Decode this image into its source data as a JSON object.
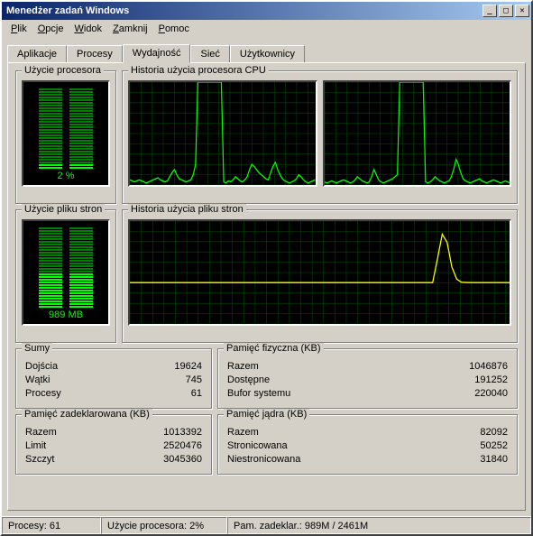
{
  "window": {
    "title": "Menedżer zadań Windows"
  },
  "menu": {
    "file": "Plik",
    "options": "Opcje",
    "view": "Widok",
    "shutdown": "Zamknij",
    "help": "Pomoc"
  },
  "tabs": {
    "apps": "Aplikacje",
    "procs": "Procesy",
    "perf": "Wydajność",
    "net": "Sieć",
    "users": "Użytkownicy"
  },
  "cpu_meter": {
    "title": "Użycie procesora",
    "label": "2 %",
    "fill_pct": 8
  },
  "cpu_history": {
    "title": "Historia użycia procesora CPU"
  },
  "pf_meter": {
    "title": "Użycie pliku stron",
    "label": "989 MB",
    "fill_pct": 42
  },
  "pf_history": {
    "title": "Historia użycia pliku stron"
  },
  "totals": {
    "title": "Sumy",
    "handles_k": "Dojścia",
    "handles_v": "19624",
    "threads_k": "Wątki",
    "threads_v": "745",
    "procs_k": "Procesy",
    "procs_v": "61"
  },
  "physmem": {
    "title": "Pamięć fizyczna (KB)",
    "total_k": "Razem",
    "total_v": "1046876",
    "avail_k": "Dostępne",
    "avail_v": "191252",
    "cache_k": "Bufor systemu",
    "cache_v": "220040"
  },
  "commit": {
    "title": "Pamięć zadeklarowana (KB)",
    "total_k": "Razem",
    "total_v": "1013392",
    "limit_k": "Limit",
    "limit_v": "2520476",
    "peak_k": "Szczyt",
    "peak_v": "3045360"
  },
  "kernel": {
    "title": "Pamięć jądra (KB)",
    "total_k": "Razem",
    "total_v": "82092",
    "paged_k": "Stronicowana",
    "paged_v": "50252",
    "nonpaged_k": "Niestronicowana",
    "nonpaged_v": "31840"
  },
  "status": {
    "procs": "Procesy: 61",
    "cpu": "Użycie procesora: 2%",
    "commit": "Pam. zadeklar.: 989M / 2461M"
  },
  "chart_data": [
    {
      "type": "line",
      "name": "cpu_history_core1",
      "ylim": [
        0,
        100
      ],
      "color": "#00ff00",
      "values": [
        5,
        4,
        3,
        4,
        5,
        4,
        3,
        2,
        3,
        4,
        5,
        6,
        7,
        5,
        4,
        3,
        4,
        8,
        12,
        15,
        10,
        6,
        5,
        4,
        3,
        4,
        5,
        10,
        20,
        100,
        100,
        100,
        100,
        100,
        100,
        100,
        100,
        100,
        100,
        100,
        3,
        2,
        4,
        3,
        5,
        8,
        6,
        4,
        3,
        5,
        8,
        15,
        20,
        18,
        15,
        12,
        10,
        8,
        6,
        5,
        12,
        18,
        22,
        15,
        10,
        6,
        4,
        3,
        2,
        3,
        4,
        6,
        10,
        8,
        5,
        3,
        2,
        3,
        4,
        5
      ]
    },
    {
      "type": "line",
      "name": "cpu_history_core2",
      "ylim": [
        0,
        100
      ],
      "color": "#00ff00",
      "values": [
        3,
        2,
        3,
        4,
        3,
        2,
        3,
        4,
        5,
        4,
        3,
        2,
        3,
        5,
        8,
        6,
        4,
        3,
        2,
        3,
        8,
        15,
        10,
        5,
        3,
        2,
        3,
        4,
        5,
        6,
        8,
        10,
        100,
        100,
        100,
        100,
        100,
        100,
        100,
        100,
        100,
        100,
        100,
        3,
        2,
        3,
        5,
        8,
        6,
        4,
        3,
        2,
        3,
        4,
        8,
        15,
        25,
        20,
        12,
        6,
        4,
        3,
        2,
        3,
        4,
        5,
        6,
        4,
        3,
        2,
        3,
        4,
        5,
        4,
        3,
        2,
        3,
        4,
        3,
        2
      ]
    },
    {
      "type": "line",
      "name": "pagefile_history",
      "ylim": [
        0,
        2520476
      ],
      "color": "#ffff00",
      "values": [
        1013000,
        1013000,
        1013000,
        1013000,
        1013000,
        1013000,
        1013000,
        1013000,
        1013000,
        1013000,
        1013000,
        1013000,
        1013000,
        1013000,
        1013000,
        1013000,
        1013000,
        1013000,
        1013000,
        1013000,
        1013000,
        1013000,
        1013000,
        1013000,
        1013000,
        1013000,
        1013000,
        1013000,
        1013000,
        1013000,
        1013000,
        1013000,
        1013000,
        1013000,
        1013000,
        1013000,
        1013000,
        1013000,
        1013000,
        1013000,
        1013000,
        1013000,
        1013000,
        1013000,
        1013000,
        1013000,
        1013000,
        1013000,
        1013000,
        1013000,
        1013000,
        1013000,
        1013000,
        1013000,
        1013000,
        1013000,
        1013000,
        1013000,
        1013000,
        1013000,
        1013000,
        1013000,
        1013000,
        1013000,
        1600000,
        2200000,
        2000000,
        1400000,
        1100000,
        1020000,
        1015000,
        1013000,
        1013000,
        1013000,
        1013000,
        1013000,
        1013000,
        1013000,
        1013000,
        1013000
      ]
    }
  ]
}
